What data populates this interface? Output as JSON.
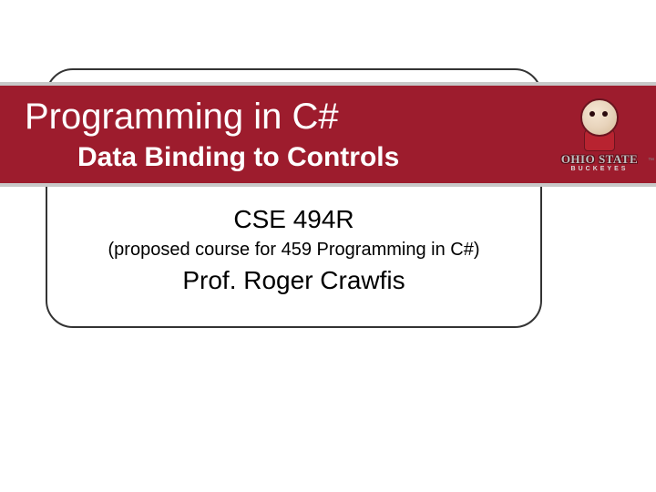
{
  "title": {
    "main": "Programming in C#",
    "sub": "Data Binding to Controls"
  },
  "course": {
    "code": "CSE 494R",
    "description": "(proposed course for 459 Programming in C#)",
    "professor": "Prof. Roger Crawfis"
  },
  "logo": {
    "line1": "OHIO STATE",
    "line2": "BUCKEYES",
    "tm": "™"
  }
}
